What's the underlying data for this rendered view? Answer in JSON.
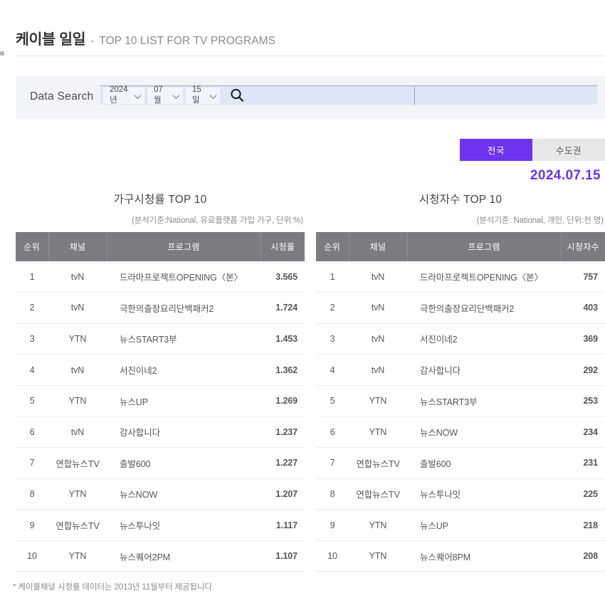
{
  "header": {
    "title_ko": "케이블 일일",
    "dash": "-",
    "title_en": "TOP 10 LIST FOR TV PROGRAMS"
  },
  "search": {
    "label": "Data Search",
    "year": "2024년",
    "month": "07월",
    "day": "15일",
    "search_icon": "search-icon"
  },
  "region": {
    "national_label": "전국",
    "metro_label": "수도권",
    "active": "전국",
    "active_color": "#6d33ee",
    "inactive_color": "#e8e8e8"
  },
  "date_display": "2024.07.15",
  "footnote": "* 케이블채널 시청률 데이터는 2013년 11월부터 제공됩니다.",
  "tables": [
    {
      "title": "가구시청률 TOP 10",
      "subtitle": "(분석기준:National, 유료플랫폼 가입 가구, 단위:%)",
      "columns": [
        "순위",
        "채널",
        "프로그램",
        "시청률"
      ],
      "rows": [
        {
          "rank": "1",
          "channel": "tvN",
          "program": "드라마프로젝트OPENING〈본〉",
          "value": "3.565"
        },
        {
          "rank": "2",
          "channel": "tvN",
          "program": "극한의출장요리단백패커2",
          "value": "1.724"
        },
        {
          "rank": "3",
          "channel": "YTN",
          "program": "뉴스START3부",
          "value": "1.453"
        },
        {
          "rank": "4",
          "channel": "tvN",
          "program": "서진이네2",
          "value": "1.362"
        },
        {
          "rank": "5",
          "channel": "YTN",
          "program": "뉴스UP",
          "value": "1.269"
        },
        {
          "rank": "6",
          "channel": "tvN",
          "program": "감사합니다",
          "value": "1.237"
        },
        {
          "rank": "7",
          "channel": "연합뉴스TV",
          "program": "출발600",
          "value": "1.227"
        },
        {
          "rank": "8",
          "channel": "YTN",
          "program": "뉴스NOW",
          "value": "1.207"
        },
        {
          "rank": "9",
          "channel": "연합뉴스TV",
          "program": "뉴스투나잇",
          "value": "1.117"
        },
        {
          "rank": "10",
          "channel": "YTN",
          "program": "뉴스퀘어2PM",
          "value": "1.107"
        }
      ]
    },
    {
      "title": "시청자수 TOP 10",
      "subtitle": "(분석기준: National, 개인, 단위:천 명)",
      "columns": [
        "순위",
        "채널",
        "프로그램",
        "시청자수"
      ],
      "rows": [
        {
          "rank": "1",
          "channel": "tvN",
          "program": "드라마프로젝트OPENING〈본〉",
          "value": "757"
        },
        {
          "rank": "2",
          "channel": "tvN",
          "program": "극한의출장요리단백패커2",
          "value": "403"
        },
        {
          "rank": "3",
          "channel": "tvN",
          "program": "서진이네2",
          "value": "369"
        },
        {
          "rank": "4",
          "channel": "tvN",
          "program": "감사합니다",
          "value": "292"
        },
        {
          "rank": "5",
          "channel": "YTN",
          "program": "뉴스START3부",
          "value": "253"
        },
        {
          "rank": "6",
          "channel": "YTN",
          "program": "뉴스NOW",
          "value": "234"
        },
        {
          "rank": "7",
          "channel": "연합뉴스TV",
          "program": "출발600",
          "value": "231"
        },
        {
          "rank": "8",
          "channel": "연합뉴스TV",
          "program": "뉴스투나잇",
          "value": "225"
        },
        {
          "rank": "9",
          "channel": "YTN",
          "program": "뉴스UP",
          "value": "218"
        },
        {
          "rank": "10",
          "channel": "YTN",
          "program": "뉴스퀘어8PM",
          "value": "208"
        }
      ]
    }
  ]
}
